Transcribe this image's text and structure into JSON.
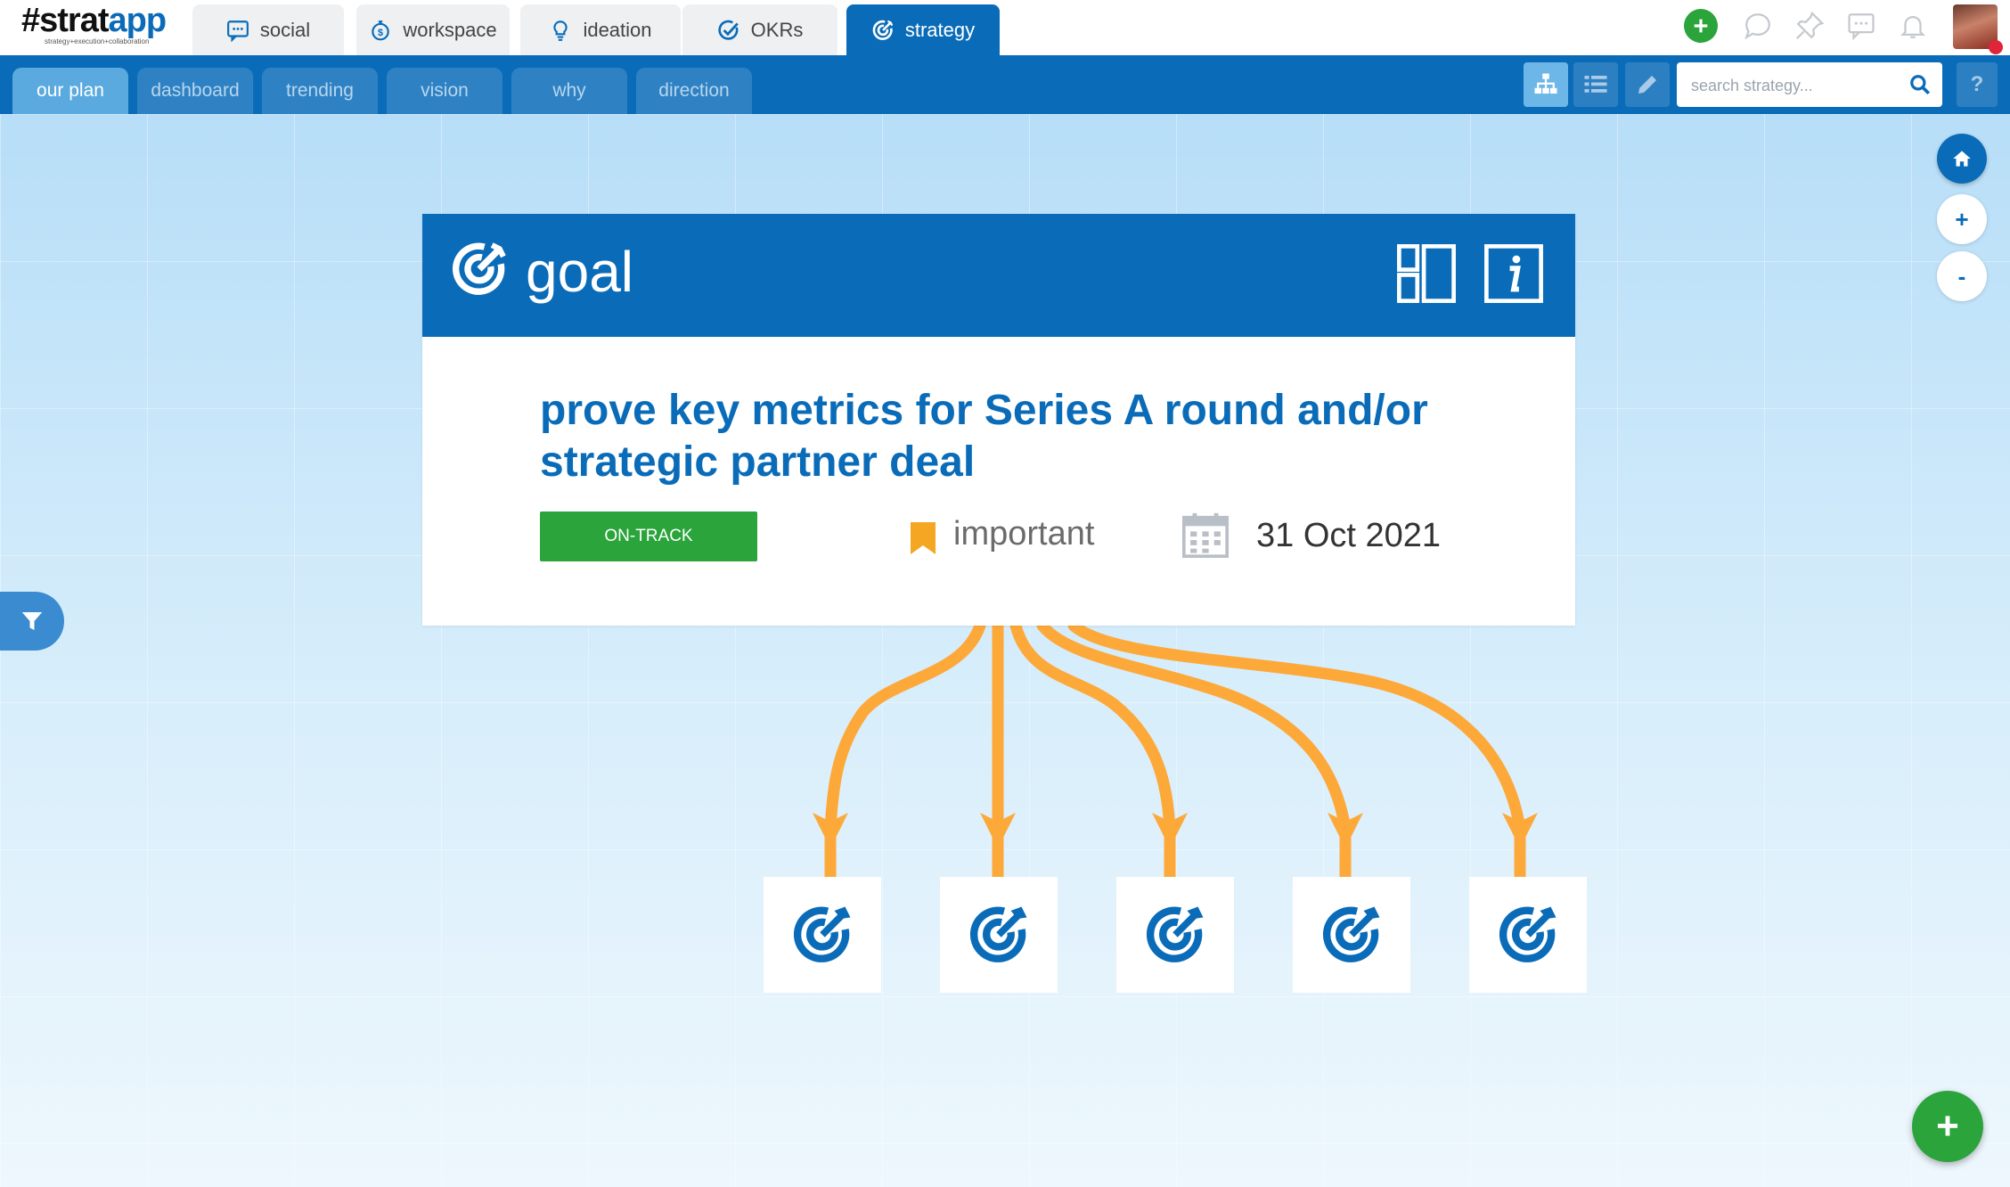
{
  "app": {
    "logo_hash_strat": "#strat",
    "logo_app": "app",
    "tagline": "strategy+execution+collaboration"
  },
  "main_tabs": [
    {
      "label": "social",
      "icon": "chat-icon"
    },
    {
      "label": "workspace",
      "icon": "stopwatch-icon"
    },
    {
      "label": "ideation",
      "icon": "lightbulb-icon"
    },
    {
      "label": "OKRs",
      "icon": "check-circle-icon"
    },
    {
      "label": "strategy",
      "icon": "target-icon",
      "active": true
    }
  ],
  "sub_tabs": [
    {
      "label": "our plan",
      "active": true
    },
    {
      "label": "dashboard"
    },
    {
      "label": "trending"
    },
    {
      "label": "vision"
    },
    {
      "label": "why"
    },
    {
      "label": "direction"
    }
  ],
  "search": {
    "placeholder": "search strategy..."
  },
  "help_label": "?",
  "zoom": {
    "in": "+",
    "out": "-"
  },
  "goal": {
    "type_label": "goal",
    "title": "prove key metrics for Series A round and/or strategic partner deal",
    "status": "ON-TRACK",
    "tag": "important",
    "due_date": "31 Oct 2021",
    "child_count": 5
  },
  "fab_label": "+",
  "colors": {
    "primary": "#0a6cb8",
    "status_green": "#2aa43b",
    "connector_orange": "#fda93a",
    "tag_orange": "#f5a623"
  }
}
